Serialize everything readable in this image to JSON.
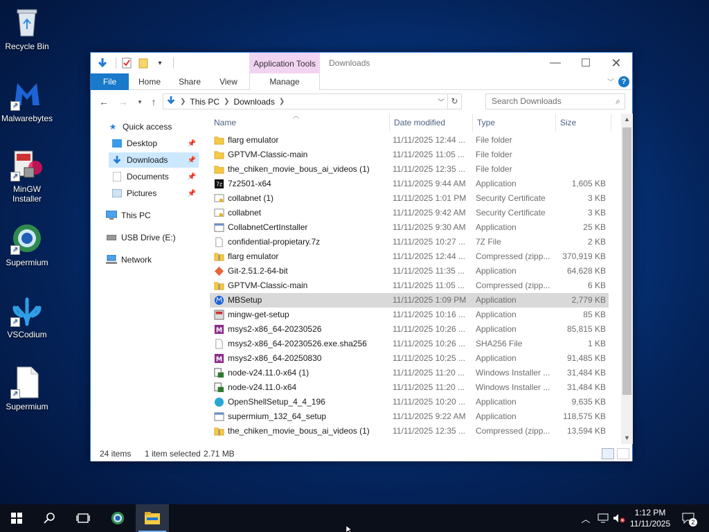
{
  "desktop": {
    "icons": [
      {
        "label": "Recycle Bin"
      },
      {
        "label": "Malwarebytes"
      },
      {
        "label": "MinGW Installer"
      },
      {
        "label": "Supermium"
      },
      {
        "label": "VSCodium"
      },
      {
        "label": "Supermium"
      }
    ]
  },
  "window": {
    "context_tab_header": "Application Tools",
    "title": "Downloads",
    "tabs": {
      "file": "File",
      "home": "Home",
      "share": "Share",
      "view": "View",
      "manage": "Manage"
    },
    "help": "?",
    "address": {
      "root": "This PC",
      "current": "Downloads"
    },
    "search_placeholder": "Search Downloads",
    "nav": {
      "quick_access": "Quick access",
      "desktop": "Desktop",
      "downloads": "Downloads",
      "documents": "Documents",
      "pictures": "Pictures",
      "this_pc": "This PC",
      "usb": "USB Drive (E:)",
      "network": "Network"
    },
    "columns": {
      "name": "Name",
      "date": "Date modified",
      "type": "Type",
      "size": "Size"
    },
    "files": [
      {
        "name": "flarg emulator",
        "date": "11/11/2025 12:44 ...",
        "type": "File folder",
        "size": "",
        "icon": "folder"
      },
      {
        "name": "GPTVM-Classic-main",
        "date": "11/11/2025 11:05 ...",
        "type": "File folder",
        "size": "",
        "icon": "folder"
      },
      {
        "name": "the_chiken_movie_bous_ai_videos (1)",
        "date": "11/11/2025 12:35 ...",
        "type": "File folder",
        "size": "",
        "icon": "folder"
      },
      {
        "name": "7z2501-x64",
        "date": "11/11/2025 9:44 AM",
        "type": "Application",
        "size": "1,605 KB",
        "icon": "7zip"
      },
      {
        "name": "collabnet (1)",
        "date": "11/11/2025 1:01 PM",
        "type": "Security Certificate",
        "size": "3 KB",
        "icon": "certificate"
      },
      {
        "name": "collabnet",
        "date": "11/11/2025 9:42 AM",
        "type": "Security Certificate",
        "size": "3 KB",
        "icon": "certificate"
      },
      {
        "name": "CollabnetCertInstaller",
        "date": "11/11/2025 9:30 AM",
        "type": "Application",
        "size": "25 KB",
        "icon": "app"
      },
      {
        "name": "confidential-propietary.7z",
        "date": "11/11/2025 10:27 ...",
        "type": "7Z File",
        "size": "2 KB",
        "icon": "file"
      },
      {
        "name": "flarg emulator",
        "date": "11/11/2025 12:44 ...",
        "type": "Compressed (zipp...",
        "size": "370,919 KB",
        "icon": "zip"
      },
      {
        "name": "Git-2.51.2-64-bit",
        "date": "11/11/2025 11:35 ...",
        "type": "Application",
        "size": "64,628 KB",
        "icon": "git"
      },
      {
        "name": "GPTVM-Classic-main",
        "date": "11/11/2025 11:05 ...",
        "type": "Compressed (zipp...",
        "size": "6 KB",
        "icon": "zip"
      },
      {
        "name": "MBSetup",
        "date": "11/11/2025 1:09 PM",
        "type": "Application",
        "size": "2,779 KB",
        "icon": "malwarebytes",
        "selected": true
      },
      {
        "name": "mingw-get-setup",
        "date": "11/11/2025 10:16 ...",
        "type": "Application",
        "size": "85 KB",
        "icon": "mingw"
      },
      {
        "name": "msys2-x86_64-20230526",
        "date": "11/11/2025 10:26 ...",
        "type": "Application",
        "size": "85,815 KB",
        "icon": "msys2"
      },
      {
        "name": "msys2-x86_64-20230526.exe.sha256",
        "date": "11/11/2025 10:26 ...",
        "type": "SHA256 File",
        "size": "1 KB",
        "icon": "file"
      },
      {
        "name": "msys2-x86_64-20250830",
        "date": "11/11/2025 10:25 ...",
        "type": "Application",
        "size": "91,485 KB",
        "icon": "msys2"
      },
      {
        "name": "node-v24.11.0-x64 (1)",
        "date": "11/11/2025 11:20 ...",
        "type": "Windows Installer ...",
        "size": "31,484 KB",
        "icon": "msi"
      },
      {
        "name": "node-v24.11.0-x64",
        "date": "11/11/2025 11:20 ...",
        "type": "Windows Installer ...",
        "size": "31,484 KB",
        "icon": "msi"
      },
      {
        "name": "OpenShellSetup_4_4_196",
        "date": "11/11/2025 10:20 ...",
        "type": "Application",
        "size": "9,635 KB",
        "icon": "openshell"
      },
      {
        "name": "supermium_132_64_setup",
        "date": "11/11/2025 9:22 AM",
        "type": "Application",
        "size": "118,575 KB",
        "icon": "app"
      },
      {
        "name": "the_chiken_movie_bous_ai_videos (1)",
        "date": "11/11/2025 12:35 ...",
        "type": "Compressed (zipp...",
        "size": "13,594 KB",
        "icon": "zip"
      }
    ],
    "status": {
      "count": "24 items",
      "selection": "1 item selected",
      "size": "2.71 MB"
    }
  },
  "taskbar": {
    "time": "1:12 PM",
    "date": "11/11/2025",
    "notification_count": "2"
  }
}
